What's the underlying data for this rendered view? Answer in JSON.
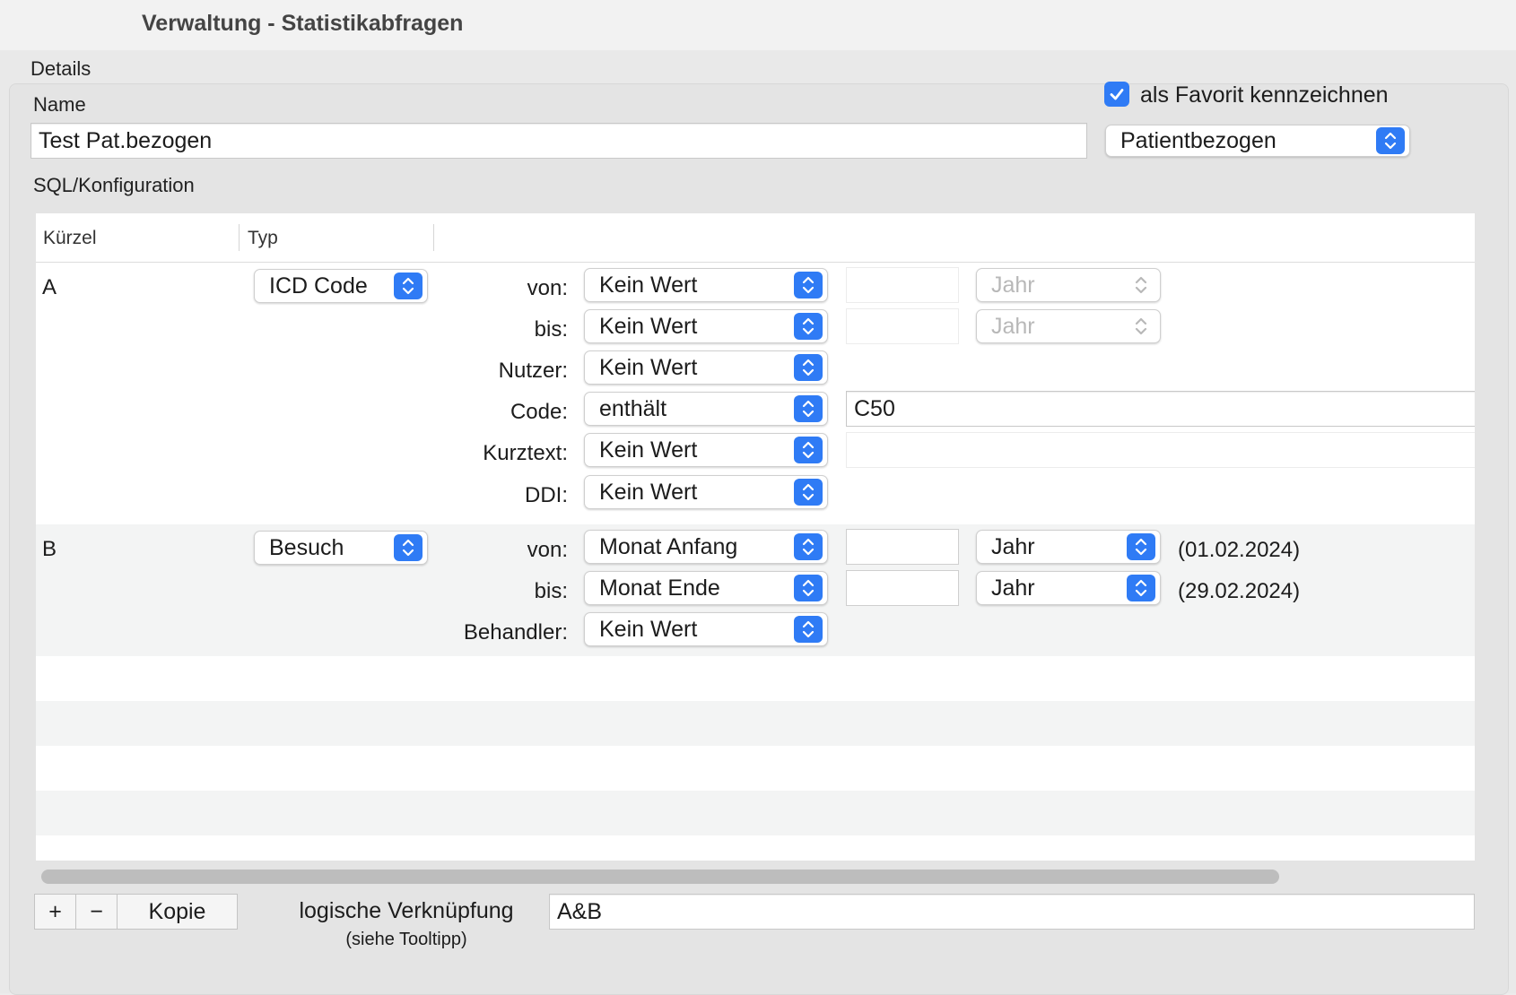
{
  "window": {
    "title": "Verwaltung - Statistikabfragen"
  },
  "details": {
    "label": "Details",
    "name_label": "Name",
    "name_value": "Test Pat.bezogen",
    "favorite_label": "als Favorit kennzeichnen",
    "favorite_checked": true,
    "scope_value": "Patientbezogen",
    "sql_label": "SQL/Konfiguration"
  },
  "table": {
    "headers": {
      "kuerzel": "Kürzel",
      "typ": "Typ"
    },
    "rows": [
      {
        "kuerzel": "A",
        "typ": "ICD Code",
        "params": [
          {
            "label": "von:",
            "value": "Kein Wert",
            "year": "Jahr"
          },
          {
            "label": "bis:",
            "value": "Kein Wert",
            "year": "Jahr"
          },
          {
            "label": "Nutzer:",
            "value": "Kein Wert"
          },
          {
            "label": "Code:",
            "value": "enthält",
            "text": "C50"
          },
          {
            "label": "Kurztext:",
            "value": "Kein Wert",
            "text": ""
          },
          {
            "label": "DDI:",
            "value": "Kein Wert"
          }
        ]
      },
      {
        "kuerzel": "B",
        "typ": "Besuch",
        "params": [
          {
            "label": "von:",
            "value": "Monat Anfang",
            "year": "Jahr",
            "date": "(01.02.2024)"
          },
          {
            "label": "bis:",
            "value": "Monat Ende",
            "year": "Jahr",
            "date": "(29.02.2024)"
          },
          {
            "label": "Behandler:",
            "value": "Kein Wert"
          }
        ]
      }
    ]
  },
  "bottom": {
    "add_label": "+",
    "remove_label": "−",
    "copy_label": "Kopie",
    "logic_label": "logische Verknüpfung",
    "logic_hint": "(siehe Tooltipp)",
    "logic_value": "A&B"
  },
  "colors": {
    "accent": "#2f7bf5"
  },
  "icons": {
    "popup": "up-down-chevron-icon",
    "checkbox": "checkmark-icon"
  }
}
